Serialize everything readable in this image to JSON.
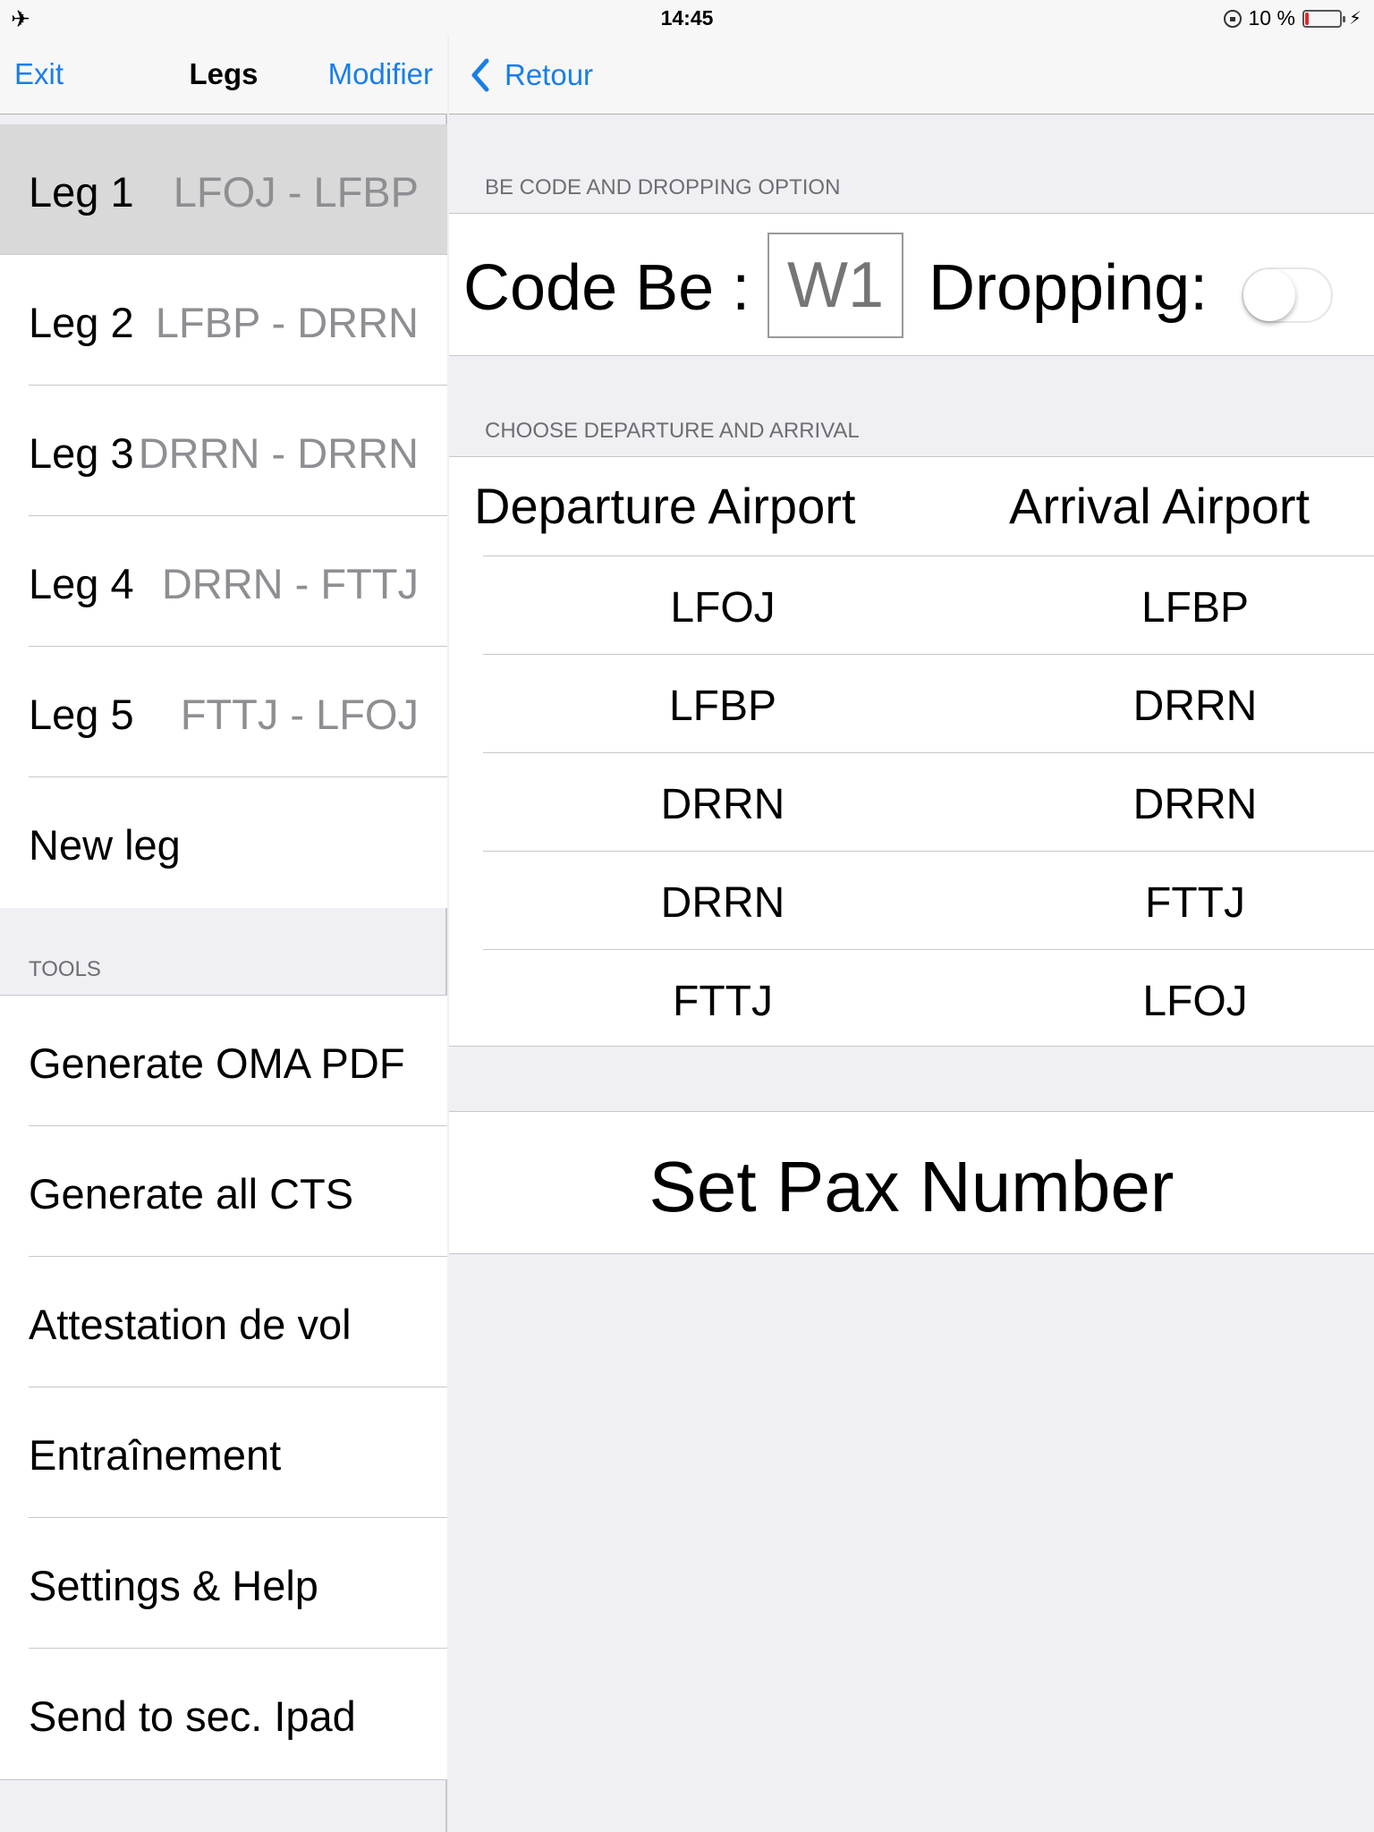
{
  "status_bar": {
    "time": "14:45",
    "battery_text": "10 %",
    "battery_level": 0.1,
    "battery_color": "#e0262b",
    "icons": [
      "airplane-icon",
      "orientation-lock-icon",
      "battery-icon",
      "charging-icon"
    ]
  },
  "left_nav": {
    "exit_label": "Exit",
    "title": "Legs",
    "modify_label": "Modifier"
  },
  "legs": [
    {
      "name": "Leg 1",
      "route": "LFOJ - LFBP",
      "selected": true
    },
    {
      "name": "Leg 2",
      "route": "LFBP - DRRN",
      "selected": false
    },
    {
      "name": "Leg 3",
      "route": "DRRN - DRRN",
      "selected": false
    },
    {
      "name": "Leg 4",
      "route": "DRRN - FTTJ",
      "selected": false
    },
    {
      "name": "Leg 5",
      "route": "FTTJ - LFOJ",
      "selected": false
    },
    {
      "name": "New leg",
      "route": "",
      "selected": false
    }
  ],
  "tools": {
    "header": "TOOLS",
    "items": [
      "Generate OMA PDF",
      "Generate all CTS",
      "Attestation de vol",
      "Entraînement",
      "Settings & Help",
      "Send to sec. Ipad"
    ]
  },
  "right_nav": {
    "back_label": "Retour"
  },
  "be_section": {
    "header": "BE CODE AND DROPPING OPTION",
    "code_label": "Code Be :",
    "code_placeholder": "W1",
    "dropping_label": "Dropping:",
    "dropping_on": false
  },
  "airport_section": {
    "header": "CHOOSE DEPARTURE AND ARRIVAL",
    "departure_header": "Departure Airport",
    "arrival_header": "Arrival Airport",
    "rows": [
      {
        "departure": "LFOJ",
        "arrival": "LFBP"
      },
      {
        "departure": "LFBP",
        "arrival": "DRRN"
      },
      {
        "departure": "DRRN",
        "arrival": "DRRN"
      },
      {
        "departure": "DRRN",
        "arrival": "FTTJ"
      },
      {
        "departure": "FTTJ",
        "arrival": "LFOJ"
      }
    ]
  },
  "pax": {
    "label": "Set Pax Number"
  },
  "accent_color": "#1a7ee8"
}
